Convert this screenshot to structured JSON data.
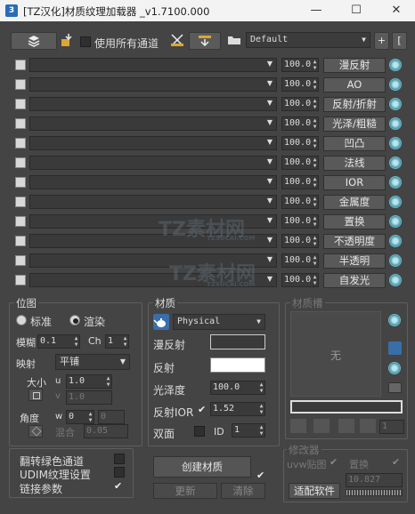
{
  "window": {
    "title": "[TZ汉化]材质纹理加载器 _v1.7100.000",
    "logo": "3",
    "minimize": "—",
    "maximize": "☐",
    "close": "✕"
  },
  "toolbar": {
    "use_all_channels": "使用所有通道",
    "preset_value": "Default",
    "add": "+"
  },
  "rows": [
    {
      "value": "100.0",
      "map": "漫反射"
    },
    {
      "value": "100.0",
      "map": "AO"
    },
    {
      "value": "100.0",
      "map": "反射/折射"
    },
    {
      "value": "100.0",
      "map": "光泽/粗糙"
    },
    {
      "value": "100.0",
      "map": "凹凸"
    },
    {
      "value": "100.0",
      "map": "法线"
    },
    {
      "value": "100.0",
      "map": "IOR"
    },
    {
      "value": "100.0",
      "map": "金属度"
    },
    {
      "value": "100.0",
      "map": "置换"
    },
    {
      "value": "100.0",
      "map": "不透明度"
    },
    {
      "value": "100.0",
      "map": "半透明"
    },
    {
      "value": "100.0",
      "map": "自发光"
    }
  ],
  "placement": {
    "title": "位图",
    "standard": "标准",
    "render": "渲染",
    "blur_label": "模糊",
    "blur_value": "0.1",
    "ch_label": "Ch",
    "ch_value": "1",
    "mapping_label": "映射",
    "mapping_value": "平铺",
    "size_label": "大小",
    "u_label": "u",
    "u_value": "1.0",
    "v_label": "v",
    "v_value": "1.0",
    "angle_label": "角度",
    "w_label": "w",
    "w_value": "0",
    "w_value2": "0",
    "blend_label": "混合",
    "blend_value": "0.05"
  },
  "material": {
    "title": "材质",
    "type": "Physical",
    "diffuse": "漫反射",
    "reflect": "反射",
    "gloss_label": "光泽度",
    "gloss_value": "100.0",
    "ior_label": "反射IOR",
    "ior_value": "1.52",
    "twosided_label": "双面",
    "id_label": "ID",
    "id_value": "1",
    "colors": {
      "diffuse": "#3a3a3a",
      "reflect": "#ffffff"
    }
  },
  "slots": {
    "title": "材质槽",
    "empty": "无",
    "count": "1"
  },
  "options": {
    "flip_green": "翻转绿色通道",
    "udim": "UDIM纹理设置",
    "link_params": "链接参数"
  },
  "actions": {
    "create": "创建材质",
    "update": "更新",
    "clear": "清除"
  },
  "modifier": {
    "title": "修改器",
    "uvw": "uvw贴图",
    "displace": "置换",
    "value": "10.827",
    "fit": "适配软件"
  },
  "watermark": {
    "text": "TZ素材网",
    "sub": "TZSUCAI.COM"
  }
}
